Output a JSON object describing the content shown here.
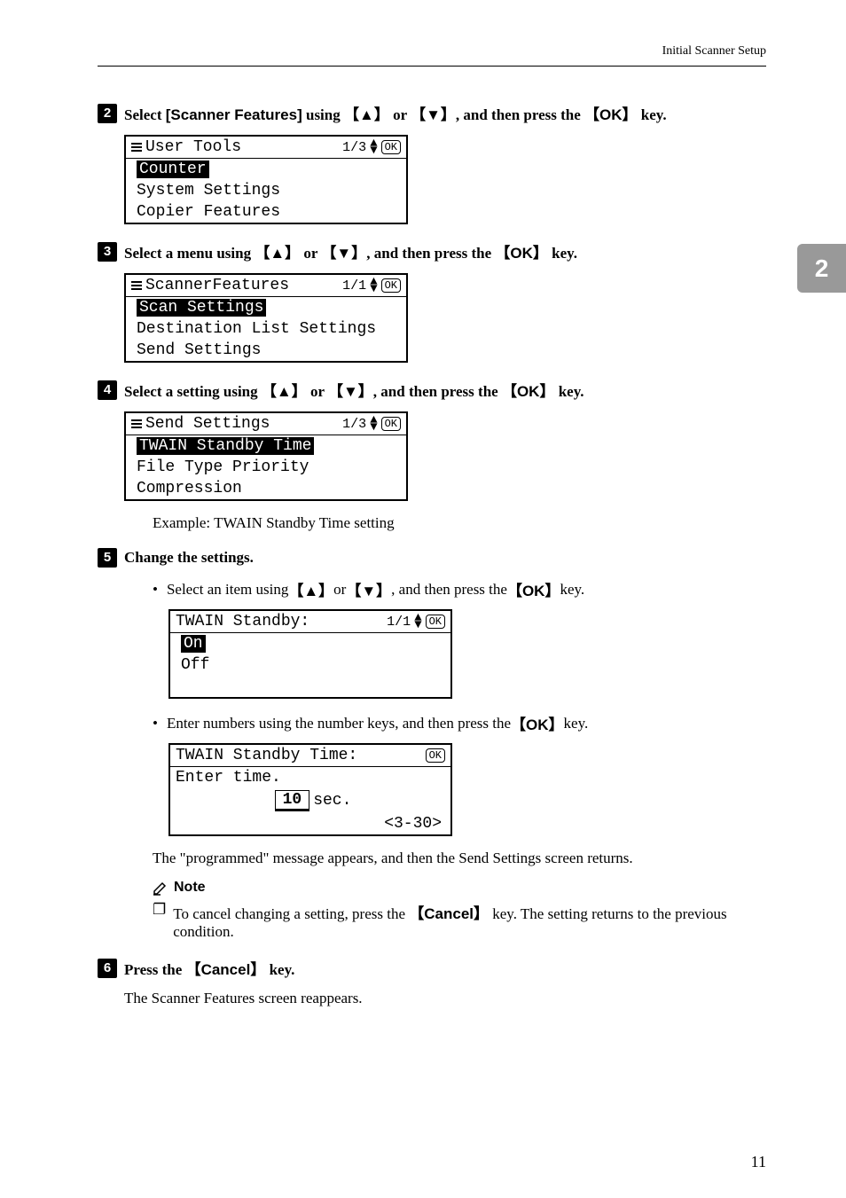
{
  "header": "Initial Scanner Setup",
  "chapterTab": "2",
  "pageNumber": "11",
  "steps": {
    "s2": {
      "num": "2",
      "pre": "Select ",
      "bold1": "[Scanner Features]",
      "mid1": " using ",
      "key1": "▲",
      "mid2": " or ",
      "key2": "▼",
      "mid3": ", and then press the ",
      "key3": "OK",
      "post": " key.",
      "lcdTitle": "User Tools",
      "lcdPage": "1/3",
      "row1": "Counter",
      "row2": "System Settings",
      "row3": "Copier Features"
    },
    "s3": {
      "num": "3",
      "pre": "Select a menu using ",
      "key1": "▲",
      "mid2": " or ",
      "key2": "▼",
      "mid3": ", and then press the ",
      "key3": "OK",
      "post": " key.",
      "lcdTitle": "ScannerFeatures",
      "lcdPage": "1/1",
      "row1": "Scan Settings",
      "row2": "Destination List Settings",
      "row3": "Send Settings"
    },
    "s4": {
      "num": "4",
      "pre": "Select a setting using ",
      "key1": "▲",
      "mid2": " or ",
      "key2": "▼",
      "mid3": ", and then press the ",
      "key3": "OK",
      "post": " key.",
      "lcdTitle": "Send Settings",
      "lcdPage": "1/3",
      "row1": "TWAIN Standby Time",
      "row2": "File Type Priority",
      "row3": "Compression",
      "example": "Example: TWAIN Standby Time setting"
    },
    "s5": {
      "num": "5",
      "text": "Change the settings.",
      "bullet1a": "Select an item using ",
      "bullet1k1": "▲",
      "bullet1b": " or ",
      "bullet1k2": "▼",
      "bullet1c": ", and then press the ",
      "bullet1k3": "OK",
      "bullet1d": " key.",
      "lcd1Title": "TWAIN Standby:",
      "lcd1Page": "1/1",
      "lcd1row1": "On",
      "lcd1row2": "Off",
      "bullet2a": "Enter numbers using the number keys, and then press the ",
      "bullet2k1": "OK",
      "bullet2b": " key.",
      "lcd2Title": "TWAIN Standby Time:",
      "lcd2row1": "Enter time.",
      "lcd2value": "10",
      "lcd2unit": "sec.",
      "lcd2range": "<3-30>",
      "afterText": "The \"programmed\" message appears, and then the Send Settings screen returns.",
      "noteLabel": "Note",
      "noteTextA": "To cancel changing a setting, press the ",
      "noteKey": "Cancel",
      "noteTextB": " key. The setting returns to the previous condition."
    },
    "s6": {
      "num": "6",
      "pre": "Press the ",
      "key1": "Cancel",
      "post": " key.",
      "after": "The Scanner Features screen reappears."
    }
  },
  "okBadge": "OK"
}
